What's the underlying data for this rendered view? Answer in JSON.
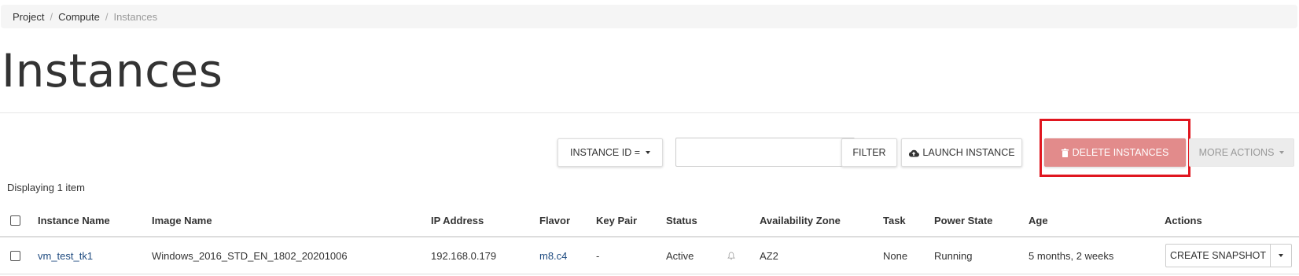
{
  "breadcrumb": [
    "Project",
    "Compute",
    "Instances"
  ],
  "page_title": "Instances",
  "toolbar": {
    "filter_field": "INSTANCE ID =",
    "search_value": "",
    "filter_label": "FILTER",
    "launch_label": "LAUNCH INSTANCE",
    "delete_label": "DELETE INSTANCES",
    "more_label": "MORE ACTIONS"
  },
  "count_text": "Displaying 1 item",
  "table": {
    "headers": [
      "Instance Name",
      "Image Name",
      "IP Address",
      "Flavor",
      "Key Pair",
      "Status",
      "Availability Zone",
      "Task",
      "Power State",
      "Age",
      "Actions"
    ],
    "rows": [
      {
        "instance_name": "vm_test_tk1",
        "image_name": "Windows_2016_STD_EN_1802_20201006",
        "ip_address": "192.168.0.179",
        "flavor": "m8.c4",
        "key_pair": "-",
        "status": "Active",
        "availability_zone": "AZ2",
        "task": "None",
        "power_state": "Running",
        "age": "5 months, 2 weeks",
        "action_label": "CREATE SNAPSHOT"
      }
    ]
  },
  "colors": {
    "delete_button": "#e28b8b",
    "highlight_box": "#e0161f",
    "link": "#1f4b80",
    "breadcrumb_bg": "#f5f5f5"
  },
  "icons": {
    "launch": "cloud-upload-icon",
    "delete": "trash-icon",
    "status": "bell-icon"
  }
}
